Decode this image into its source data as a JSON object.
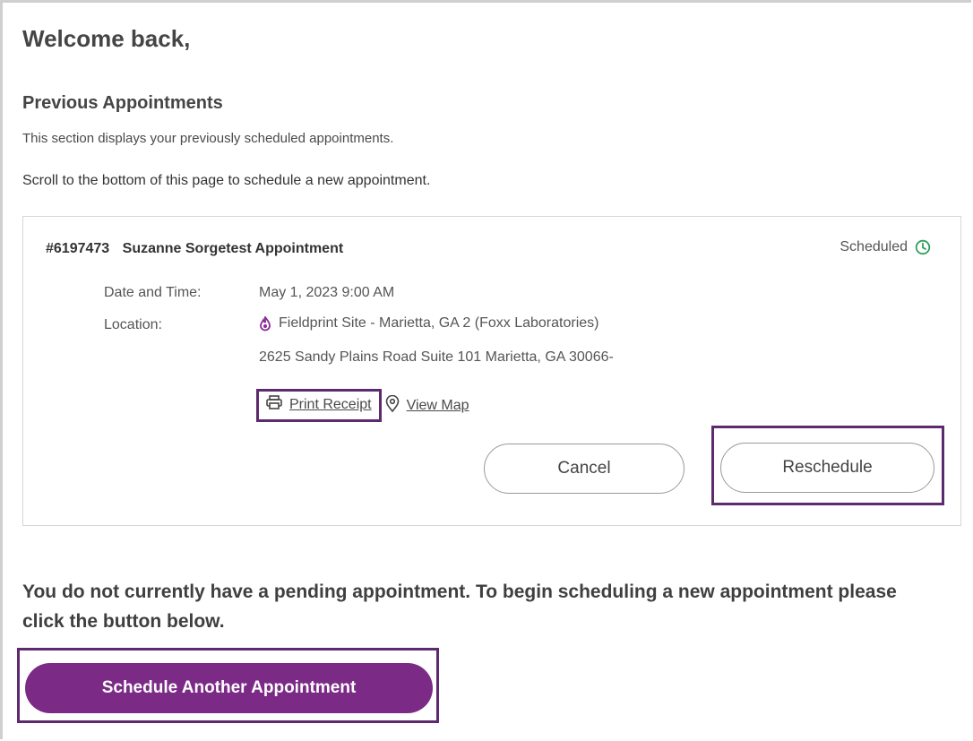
{
  "header": {
    "welcome": "Welcome back,"
  },
  "previous": {
    "title": "Previous Appointments",
    "description": "This section displays your previously scheduled appointments.",
    "scroll_hint": "Scroll to the bottom of this page to schedule a new appointment."
  },
  "appointment": {
    "number": "#6197473",
    "name": "Suzanne Sorgetest Appointment",
    "status": "Scheduled",
    "status_color": "#2e9e5b",
    "date_label": "Date and Time:",
    "date_value": "May 1, 2023 9:00 AM",
    "location_label": "Location:",
    "site_name": "Fieldprint Site - Marietta, GA 2 (Foxx Laboratories)",
    "address": "2625 Sandy Plains Road Suite 101 Marietta, GA 30066-",
    "print_label": "Print Receipt",
    "map_label": "View Map",
    "cancel_label": "Cancel",
    "reschedule_label": "Reschedule",
    "icons": {
      "status": "clock-icon",
      "site": "location-drop-icon",
      "print": "printer-icon",
      "map": "map-pin-icon"
    }
  },
  "pending": {
    "message": "You do not currently have a pending appointment. To begin scheduling a new appointment please click the button below.",
    "schedule_label": "Schedule Another Appointment"
  },
  "colors": {
    "accent": "#7b2a86",
    "highlight_border": "#5e2a6e"
  }
}
